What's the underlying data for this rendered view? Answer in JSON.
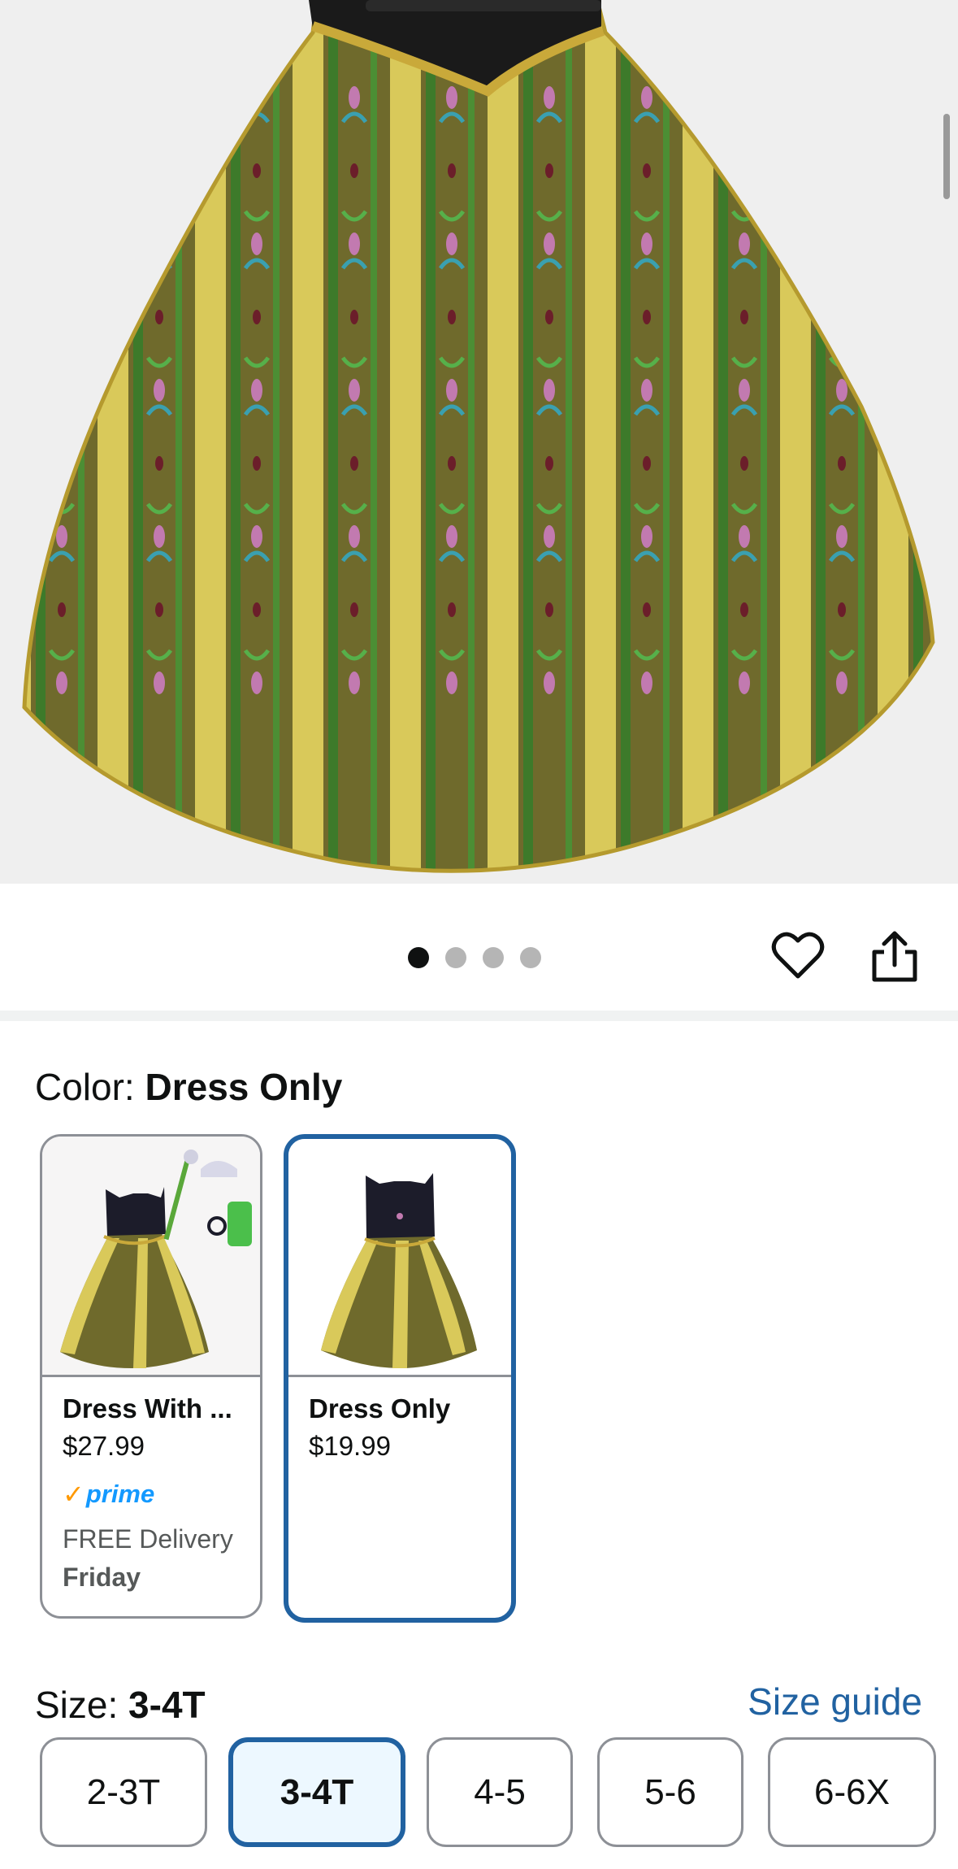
{
  "gallery": {
    "dots_count": 4,
    "active_dot": 0,
    "favorite_icon": "heart-icon",
    "share_icon": "share-icon"
  },
  "color": {
    "label": "Color: ",
    "selected": "Dress Only",
    "options": [
      {
        "name": "Dress With ...",
        "price": "$27.99",
        "prime": "prime",
        "delivery": "FREE Delivery",
        "delivery_day": "Friday",
        "selected": false
      },
      {
        "name": "Dress Only",
        "price": "$19.99",
        "selected": true
      }
    ]
  },
  "size": {
    "label": "Size: ",
    "selected": "3-4T",
    "guide_link": "Size guide",
    "options": [
      "2-3T",
      "3-4T",
      "4-5",
      "5-6",
      "6-6X"
    ]
  },
  "colors": {
    "accent": "#2162a1",
    "prime": "#1399ff",
    "prime_check": "#ff9900"
  }
}
